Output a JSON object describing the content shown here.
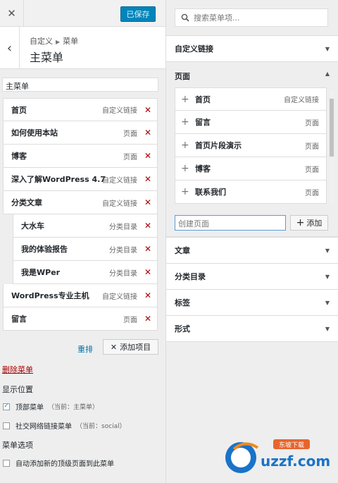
{
  "topbar": {
    "close_icon": "close-icon",
    "save_label": "已保存"
  },
  "header": {
    "breadcrumb_parent": "自定义",
    "breadcrumb_child": "菜单",
    "title": "主菜单"
  },
  "menu_name_value": "主菜单",
  "menu_items": [
    {
      "label": "首页",
      "type": "自定义链接",
      "sub": false
    },
    {
      "label": "如何使用本站",
      "type": "页面",
      "sub": false
    },
    {
      "label": "博客",
      "type": "页面",
      "sub": false
    },
    {
      "label": "深入了解WordPress 4.7",
      "type": "自定义链接",
      "sub": false
    },
    {
      "label": "分类文章",
      "type": "自定义链接",
      "sub": false
    },
    {
      "label": "大水车",
      "type": "分类目录",
      "sub": true
    },
    {
      "label": "我的体验报告",
      "type": "分类目录",
      "sub": true
    },
    {
      "label": "我是WPer",
      "type": "分类目录",
      "sub": true
    },
    {
      "label": "WordPress专业主机",
      "type": "自定义链接",
      "sub": false
    },
    {
      "label": "留言",
      "type": "页面",
      "sub": false
    }
  ],
  "actions": {
    "reorder_label": "重排",
    "add_items_label": "添加项目",
    "delete_menu_label": "删除菜单"
  },
  "locations": {
    "title": "显示位置",
    "primary": {
      "label": "顶部菜单",
      "hint": "（当前：主菜单）",
      "checked": true
    },
    "social": {
      "label": "社交网络链接菜单",
      "hint": "（当前：social）",
      "checked": false
    }
  },
  "options": {
    "title": "菜单选项",
    "auto_add_label": "自动添加新的顶级页面到此菜单",
    "checked": false
  },
  "search": {
    "placeholder": "搜索菜单项..."
  },
  "panels": {
    "custom_links": "自定义链接",
    "pages": "页面",
    "posts": "文章",
    "categories": "分类目录",
    "tags": "标签",
    "formats": "形式"
  },
  "page_list": [
    {
      "label": "首页",
      "type": "自定义链接"
    },
    {
      "label": "留言",
      "type": "页面"
    },
    {
      "label": "首页片段演示",
      "type": "页面"
    },
    {
      "label": "博客",
      "type": "页面"
    },
    {
      "label": "联系我们",
      "type": "页面"
    }
  ],
  "new_page": {
    "placeholder": "创建页面",
    "add_label": "添加"
  },
  "watermark": {
    "text": "uzzf.com",
    "badge": "东坡下载"
  },
  "colors": {
    "primary": "#0085ba",
    "delete": "#a00",
    "link": "#0073aa",
    "bg": "#eeeeee"
  }
}
